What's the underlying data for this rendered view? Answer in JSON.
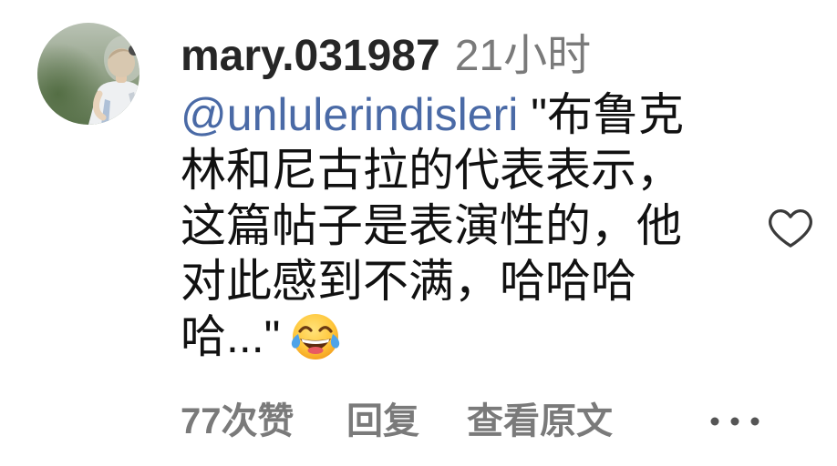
{
  "comment": {
    "username": "mary.031987",
    "timestamp": "21小时",
    "mention": "@unlulerindisleri",
    "lines": [
      " \"布鲁克",
      "林和尼古拉的代表表示，",
      "这篇帖子是表演性的，他",
      "对此感到不满，哈哈哈",
      "哈...\""
    ],
    "emoji": "face-with-tears-of-joy-icon"
  },
  "actions": {
    "likes": "77次赞",
    "reply": "回复",
    "translate": "查看原文"
  },
  "icons": {
    "like": "heart-outline-icon",
    "more": "more-options-icon",
    "avatar": "user-avatar-photo"
  },
  "colors": {
    "background": "#ffffff",
    "text": "#111111",
    "username": "#262626",
    "secondary": "#7a7a7a",
    "mention": "#4a6aa6",
    "icon": "#3a3a3a"
  }
}
